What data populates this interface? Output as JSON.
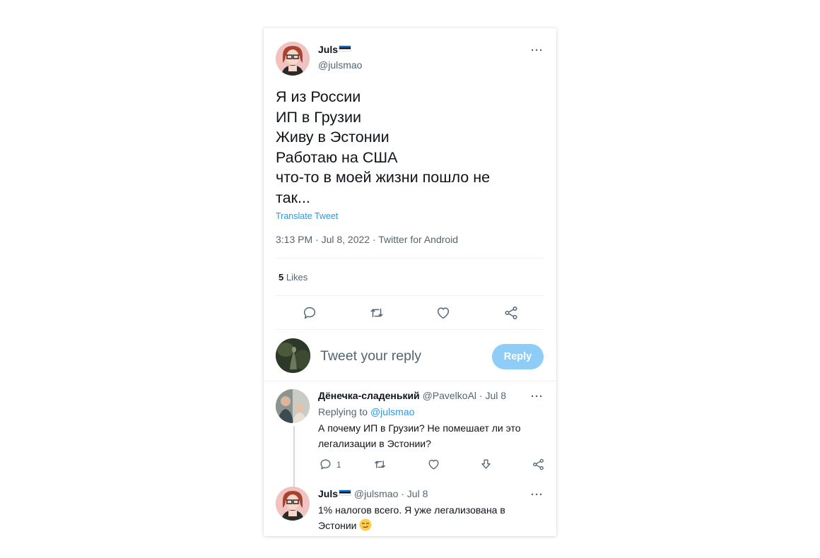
{
  "tweet": {
    "author_name": "Juls",
    "author_handle": "@julsmao",
    "more": "···",
    "lines": [
      "Я из России",
      "ИП в Грузии",
      "Живу в Эстонии",
      "Работаю на США",
      "что-то в моей жизни пошло не",
      "так..."
    ],
    "translate": "Translate Tweet",
    "meta": "3:13 PM · Jul 8, 2022 · Twitter for Android",
    "likes_count": "5",
    "likes_label": "Likes"
  },
  "compose": {
    "placeholder": "Tweet your reply",
    "button": "Reply"
  },
  "replies": [
    {
      "name": "Дёнечка-сладенький",
      "handle": "@PavelkoAl",
      "date": "· Jul 8",
      "replying_prefix": "Replying to",
      "replying_to": "@julsmao",
      "text_lines": [
        "А почему ИП в Грузии? Не помешает ли это",
        "легализации в Эстонии?"
      ],
      "reply_count": "1"
    },
    {
      "name": "Juls",
      "handle": "@julsmao",
      "date": "· Jul 8",
      "text_lines": [
        "1% налогов всего. Я уже легализована в",
        "Эстонии"
      ]
    }
  ],
  "colors": {
    "accent": "#1d9bf0",
    "reply_button": "#8ecdf8",
    "secondary_text": "#536471"
  },
  "icons": {
    "reply": "reply-icon",
    "retweet": "retweet-icon",
    "like": "heart-icon",
    "share": "share-icon",
    "download": "download-icon",
    "emoji": "smirk-emoji-icon",
    "flag": "estonia-flag-icon"
  }
}
